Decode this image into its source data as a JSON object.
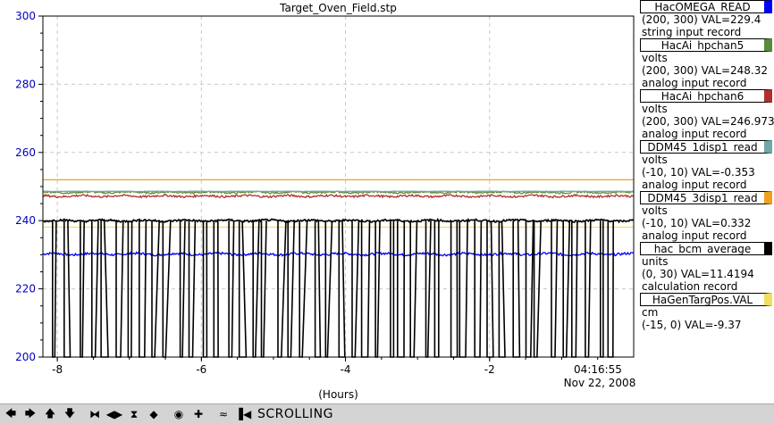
{
  "chart_data": {
    "type": "line",
    "title": "Target_Oven_Field.stp",
    "xlabel": "(Hours)",
    "x_ticks": [
      "-8",
      "-6",
      "-4",
      "-2"
    ],
    "x_end_label_time": "04:16:55",
    "x_end_label_date": "Nov 22, 2008",
    "xlim": [
      -8.2,
      0
    ],
    "y_ticks": [
      "300",
      "280",
      "260",
      "240",
      "220",
      "200"
    ],
    "ylim": [
      200,
      300
    ],
    "grid": true,
    "series": [
      {
        "name": "HacOMEGA_READ",
        "color": "#0000ff",
        "range": "(200, 300)",
        "value": "VAL=229.4",
        "units": "",
        "record": "string input record",
        "level": 230.2,
        "noise": 0.35
      },
      {
        "name": "HacAi_hpchan5",
        "color": "#5a8a3a",
        "range": "(200, 300)",
        "value": "VAL=248.32",
        "units": "volts",
        "record": "analog input record",
        "level": 248.3,
        "noise": 0.25
      },
      {
        "name": "HacAi_hpchan6",
        "color": "#b03030",
        "range": "(200, 300)",
        "value": "VAL=246.973",
        "units": "volts",
        "record": "analog input record",
        "level": 247.2,
        "noise": 0.3
      },
      {
        "name": "DDM45_1disp1_read",
        "color": "#6fa8a8",
        "range": "(-10, 10)",
        "value": "VAL=-0.353",
        "units": "volts",
        "record": "analog input record",
        "level": 248.6,
        "noise": 0.05
      },
      {
        "name": "DDM45_3disp1_read",
        "color": "#f0a020",
        "range": "(-10, 10)",
        "value": "VAL=0.332",
        "units": "volts",
        "record": "analog input record",
        "level": 252.0,
        "noise": 0
      },
      {
        "name": "hac_bcm_average",
        "color": "#000000",
        "range": "(0, 30)",
        "value": "VAL=11.4194",
        "units": "units",
        "record": "calculation record",
        "level": 240.0,
        "noise": 0.3
      },
      {
        "name": "HaGenTargPos.VAL",
        "color": "#f0e060",
        "range": "(-15, 0)",
        "value": "VAL=-9.37",
        "units": "cm",
        "record": "",
        "level": 238.1,
        "noise": 0
      }
    ]
  },
  "toolbar": {
    "buttons": [
      {
        "name": "pan-left-icon",
        "glyph": "🡄"
      },
      {
        "name": "pan-right-icon",
        "glyph": "🡆"
      },
      {
        "name": "pan-up-icon",
        "glyph": "🡅"
      },
      {
        "name": "pan-down-icon",
        "glyph": "🡇"
      },
      {
        "name": "zoom-in-x-icon",
        "glyph": "⧓"
      },
      {
        "name": "zoom-out-x-icon",
        "glyph": "◀▶"
      },
      {
        "name": "zoom-in-y-icon",
        "glyph": "⧗"
      },
      {
        "name": "zoom-out-y-icon",
        "glyph": "◆"
      },
      {
        "name": "auto-scale-icon",
        "glyph": "◉"
      },
      {
        "name": "add-icon",
        "glyph": "✚"
      },
      {
        "name": "strip-chart-icon",
        "glyph": "≈"
      },
      {
        "name": "scroll-icon",
        "glyph": "▐◀"
      }
    ],
    "status": "SCROLLING"
  }
}
